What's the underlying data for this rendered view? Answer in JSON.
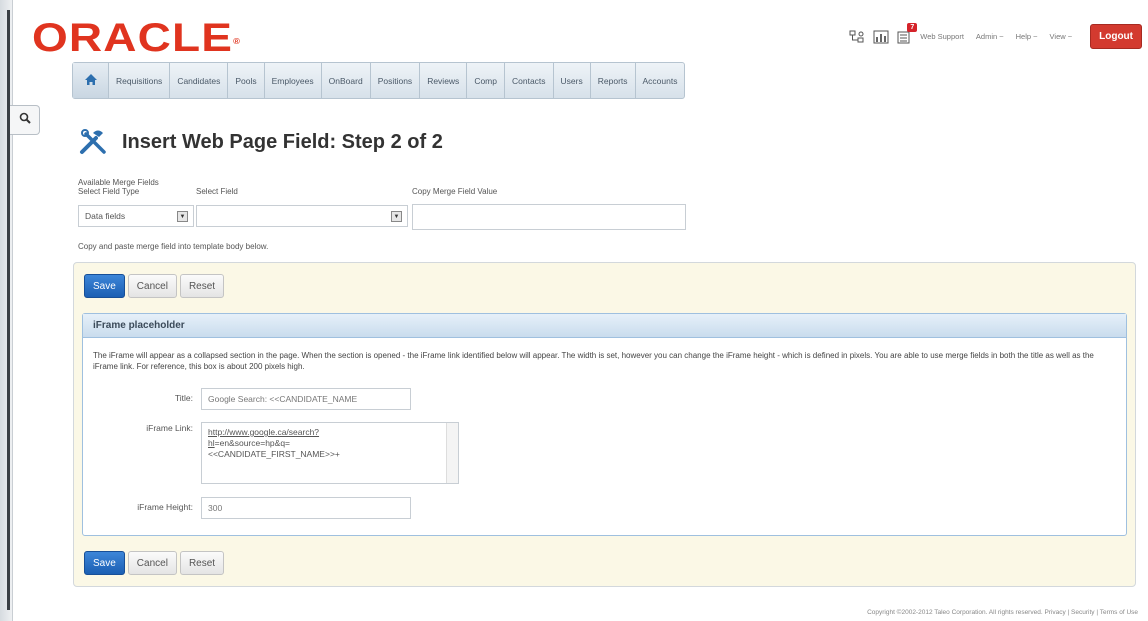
{
  "header": {
    "logo": "ORACLE",
    "links": [
      "Web Support",
      "Admin ~",
      "Help ~",
      "View ~"
    ],
    "notification_count": "7",
    "logout_label": "Logout"
  },
  "nav": {
    "items": [
      "Requisitions",
      "Candidates",
      "Pools",
      "Employees",
      "OnBoard",
      "Positions",
      "Reviews",
      "Comp",
      "Contacts",
      "Users",
      "Reports",
      "Accounts"
    ]
  },
  "page": {
    "title": "Insert Web Page Field: Step 2 of 2"
  },
  "merge": {
    "heading": "Available Merge Fields",
    "field_type_label": "Select Field Type",
    "field_type_value": "Data fields",
    "select_field_label": "Select Field",
    "select_field_value": "",
    "copy_value_label": "Copy Merge Field Value",
    "copy_value": "",
    "help_text": "Copy and paste merge field into template body below."
  },
  "buttons": {
    "save": "Save",
    "cancel": "Cancel",
    "reset": "Reset"
  },
  "panel": {
    "title": "iFrame placeholder",
    "description": "The iFrame will appear as a collapsed section in the page. When the section is opened - the iFrame link identified below will appear. The width is set, however you can change the iFrame height - which is defined in pixels. You are able to use merge fields in both the title as well as the iFrame link. For reference, this box is about 200 pixels high.",
    "title_label": "Title:",
    "title_value": "Google Search: <<CANDIDATE_NAME",
    "link_label": "iFrame Link:",
    "link_line1": "http://www.google.ca/search?",
    "link_line2": "hl=en&source=hp&q=",
    "link_line3": "<<CANDIDATE_FIRST_NAME>>+",
    "height_label": "iFrame Height:",
    "height_value": "300"
  },
  "footer": {
    "text": "Copyright ©2002-2012 Taleo Corporation. All rights reserved. Privacy | Security | Terms of Use"
  }
}
